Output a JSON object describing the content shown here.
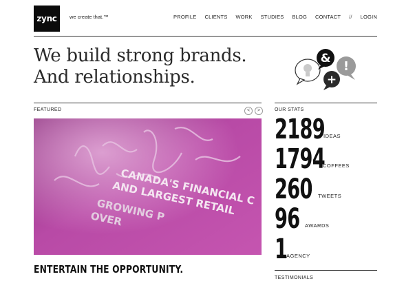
{
  "brand": {
    "logo_text": "zync",
    "tagline": "we create that.™"
  },
  "nav": {
    "items": [
      "PROFILE",
      "CLIENTS",
      "WORK",
      "STUDIES",
      "BLOG",
      "CONTACT"
    ],
    "separator": "//",
    "login": "LOGIN"
  },
  "hero": {
    "line1": "We build strong brands.",
    "line2": "And relationships."
  },
  "hero_icon_glyphs": {
    "ampersand": "&",
    "exclamation": "!",
    "plus": "+"
  },
  "featured": {
    "label": "FEATURED",
    "prev": "<",
    "next": ">",
    "image_text": {
      "line1": "CANADA'S FINANCIAL C",
      "line2": "AND LARGEST RETAIL",
      "line3": "GROWING P",
      "line4": "OVER"
    },
    "title": "ENTERTAIN THE OPPORTUNITY."
  },
  "stats": {
    "label": "OUR STATS",
    "items": [
      {
        "value": "2189",
        "label": "IDEAS"
      },
      {
        "value": "1794",
        "label": "COFFEES"
      },
      {
        "value": "260",
        "label": "TWEETS"
      },
      {
        "value": "96",
        "label": "AWARDS"
      },
      {
        "value": "1",
        "label": "AGENCY"
      }
    ]
  },
  "testimonials": {
    "label": "TESTIMONIALS"
  },
  "colors": {
    "feature_magenta": "#b0449e",
    "ink": "#111111"
  }
}
